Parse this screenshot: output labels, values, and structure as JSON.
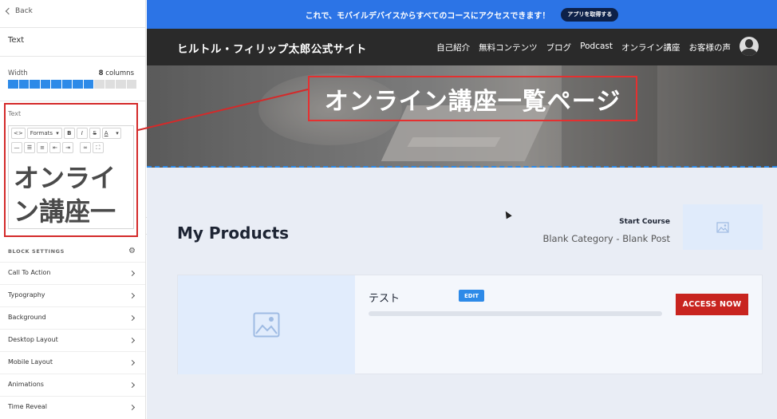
{
  "sidebar": {
    "back_label": "Back",
    "title": "Text",
    "width_label": "Width",
    "width_columns": "8",
    "width_unit": "columns",
    "width_filled": 8,
    "width_total": 12,
    "text_label": "Text",
    "toolbar": {
      "row1": [
        "<>",
        "Formats",
        "B",
        "I",
        "S",
        "A"
      ],
      "row2": [
        "—",
        "bullet-list",
        "numbered-list",
        "outdent",
        "indent",
        "link",
        "fullscreen"
      ]
    },
    "editor_text": "オンライン講座一",
    "block_settings_label": "BLOCK SETTINGS",
    "settings_items": [
      "Call To Action",
      "Typography",
      "Background",
      "Desktop Layout",
      "Mobile Layout",
      "Animations",
      "Time Reveal"
    ]
  },
  "preview": {
    "banner_text": "これで、モバイルデバイスからすべてのコースにアクセスできます！",
    "banner_button": "アプリを取得する",
    "site_title": "ヒルトル・フィリップ太郎公式サイト",
    "nav": [
      "自己紹介",
      "無料コンテンツ",
      "ブログ",
      "Podcast",
      "オンライン講座",
      "お客様の声"
    ],
    "hero_title": "オンライン講座一覧ページ",
    "section_title": "My Products",
    "start_course_label": "Start Course",
    "start_course_detail": "Blank Category - Blank Post",
    "product": {
      "title": "テスト",
      "edit_label": "EDIT",
      "progress": 0,
      "access_label": "ACCESS NOW"
    }
  },
  "colors": {
    "banner": "#2c74e6",
    "navbar": "#2a2a2a",
    "accent_blue": "#2d8ae8",
    "access_button": "#c8241f",
    "annotation_red": "#d42a2a"
  }
}
